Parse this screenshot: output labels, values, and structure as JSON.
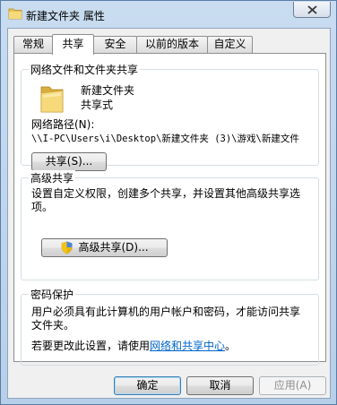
{
  "window": {
    "title": "新建文件夹 属性"
  },
  "tabs": [
    "常规",
    "共享",
    "安全",
    "以前的版本",
    "自定义"
  ],
  "network_sharing": {
    "section_title": "网络文件和文件夹共享",
    "folder_name": "新建文件夹",
    "share_state": "共享式",
    "path_label": "网络路径(N):",
    "path_value": "\\\\I-PC\\Users\\i\\Desktop\\新建文件夹 (3)\\游戏\\新建文件",
    "share_button": "共享(S)..."
  },
  "advanced_sharing": {
    "section_title": "高级共享",
    "description": "设置自定义权限，创建多个共享，并设置其他高级共享选项。",
    "button": "高级共享(D)..."
  },
  "password_protection": {
    "section_title": "密码保护",
    "description": "用户必须具有此计算机的用户帐户和密码，才能访问共享文件夹。",
    "change_prefix": "若要更改此设置，请使用",
    "link_text": "网络和共享中心",
    "change_suffix": "。"
  },
  "footer": {
    "ok": "确定",
    "cancel": "取消",
    "apply": "应用(A)"
  }
}
